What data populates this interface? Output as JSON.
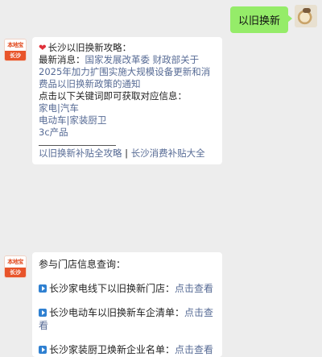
{
  "user_message": "以旧换新",
  "bot_avatar": {
    "logo_top": "本地宝",
    "logo_bottom": "长沙"
  },
  "card1": {
    "heading": "长沙以旧换新攻略：",
    "news_label": "最新消息：",
    "news_link": "国家发展改革委 财政部关于2025年加力扩围实施大规模设备更新和消费品以旧换新政策的通知",
    "prompt": "点击以下关键词即可获取对应信息：",
    "keywords": [
      "家电|汽车",
      "电动车|家装厨卫",
      "3c产品"
    ],
    "footer_link1": "以旧换新补贴全攻略",
    "footer_sep": " | ",
    "footer_link2": "长沙消费补贴大全"
  },
  "card2": {
    "heading": "参与门店信息查询：",
    "items": [
      {
        "text": "长沙家电线下以旧换新门店：",
        "link": "点击查看"
      },
      {
        "text": "长沙电动车以旧换新车企清单：",
        "link": "点击查看"
      },
      {
        "text": "长沙家装厨卫焕新企业名单：",
        "link": "点击查看"
      }
    ]
  }
}
